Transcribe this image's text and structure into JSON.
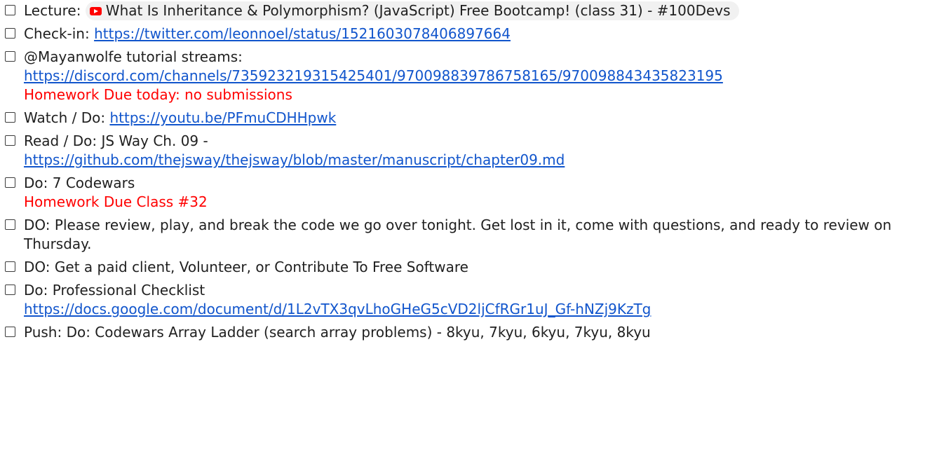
{
  "items": [
    {
      "label": "Lecture: ",
      "chip_text": "What Is Inheritance & Polymorphism? (JavaScript) Free Bootcamp! (class 31) - #100Devs"
    },
    {
      "label": "Check-in: ",
      "link": "https://twitter.com/leonnoel/status/1521603078406897664"
    },
    {
      "label": " @Mayanwolfe tutorial streams:",
      "link": "https://discord.com/channels/735923219315425401/970098839786758165/970098843435823195",
      "note": "Homework Due today: no submissions"
    },
    {
      "label": "Watch / Do: ",
      "link": "https://youtu.be/PFmuCDHHpwk"
    },
    {
      "label": "Read / Do: JS Way Ch. 09 -",
      "link": "https://github.com/thejsway/thejsway/blob/master/manuscript/chapter09.md"
    },
    {
      "label": "Do: 7 Codewars",
      "note": "Homework Due Class #32"
    },
    {
      "label": "DO: Please review, play, and break the code we go over tonight. Get lost in it, come with questions, and ready to review on Thursday."
    },
    {
      "label": "DO: Get a paid client, Volunteer, or Contribute To Free Software"
    },
    {
      "label": "Do: Professional Checklist",
      "link": "https://docs.google.com/document/d/1L2vTX3qvLhoGHeG5cVD2ljCfRGr1uJ_Gf-hNZj9KzTg"
    },
    {
      "label": "Push: Do: Codewars Array Ladder (search array problems) - 8kyu, 7kyu, 6kyu, 7kyu, 8kyu"
    }
  ],
  "icons": {
    "chip_icon": "youtube-icon",
    "checkbox_icon": "checkbox-unchecked"
  },
  "colors": {
    "link": "#1155cc",
    "note": "#ff0000",
    "youtube": "#ff0000",
    "chip_bg": "#f1f1f1"
  }
}
